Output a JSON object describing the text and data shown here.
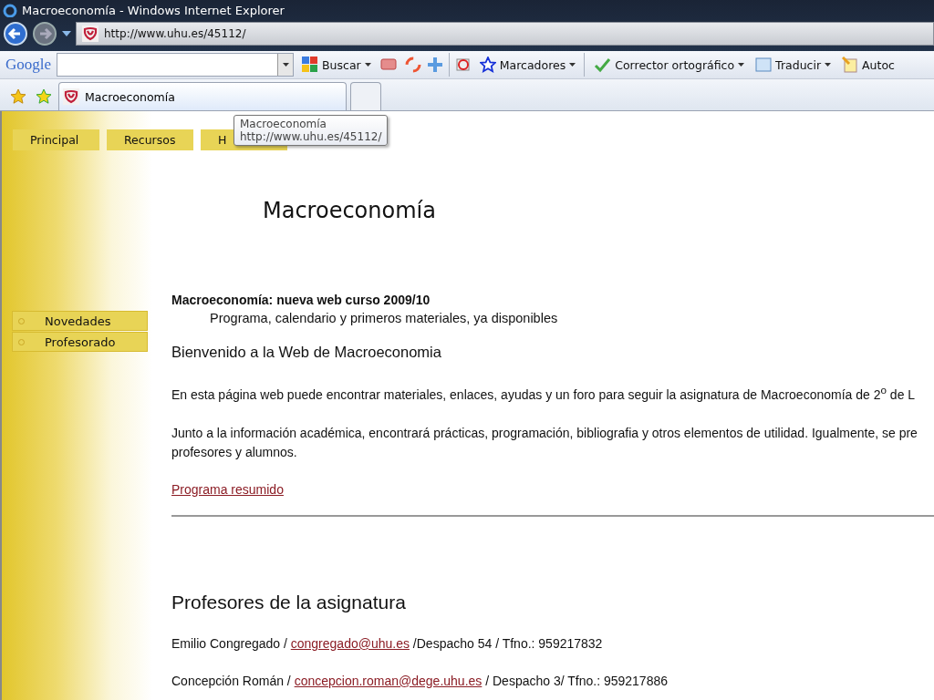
{
  "window": {
    "title": "Macroeconomía - Windows Internet Explorer"
  },
  "address_bar": {
    "url": "http://www.uhu.es/45112/"
  },
  "google_toolbar": {
    "logo": "Google",
    "items": [
      {
        "kind": "search",
        "label": "Buscar"
      },
      {
        "kind": "icons"
      },
      {
        "kind": "bookmarks",
        "label": "Marcadores"
      },
      {
        "kind": "spell",
        "label": "Corrector ortográfico"
      },
      {
        "kind": "translate",
        "label": "Traducir"
      },
      {
        "kind": "autofill",
        "label": "Autoc"
      }
    ]
  },
  "tabs": [
    {
      "label": "Macroeconomía",
      "selected": true
    },
    {
      "selected": false
    }
  ],
  "tooltip": {
    "title": "Macroeconomía",
    "url": "http://www.uhu.es/45112/"
  },
  "top_menu": [
    {
      "label": "Principal"
    },
    {
      "label": "Recursos"
    },
    {
      "label": "H"
    }
  ],
  "page_title": "Macroeconomía",
  "side_menu": [
    {
      "label": "Novedades"
    },
    {
      "label": "Profesorado"
    }
  ],
  "news": {
    "title": "Macroeconomía: nueva web curso 2009/10",
    "text": "Programa, calendario y primeros materiales, ya disponibles"
  },
  "welcome": "Bienvenido a la Web de Macroeconomia",
  "paragraphs": [
    "En esta página web puede encontrar materiales, enlaces, ayudas y un foro para seguir la asignatura de Macroeconomía de 2$^{o}$ de L",
    "Junto a la información académica, encontrará prácticas, programación, bibliografia y otros elementos de utilidad. Igualmente, se pre\nprofesores y alumnos."
  ],
  "program_link": "Programa resumido",
  "professors": {
    "heading": "Profesores de la asignatura",
    "rows": [
      {
        "name": "Emilio Congregado /",
        "email": "congregado@uhu.es",
        "details": "/Despacho 54 / Tfno.: 959217832"
      },
      {
        "name": "Concepción Román /",
        "email": "concepcion.roman@dege.uhu.es",
        "details": "/ Despacho 3/ Tfno.: 959217886"
      }
    ]
  }
}
